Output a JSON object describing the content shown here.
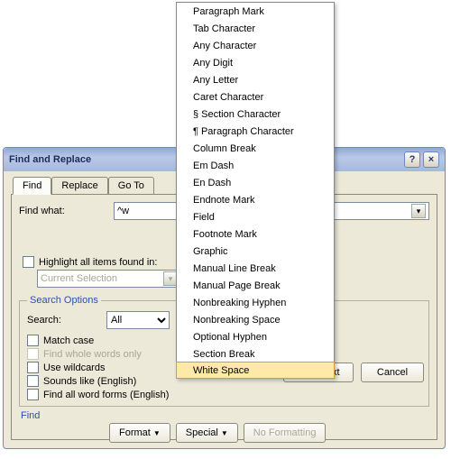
{
  "dialog": {
    "title": "Find and Replace"
  },
  "tabs": {
    "find": "Find",
    "replace": "Replace",
    "goto": "Go To"
  },
  "findwhat": {
    "label": "Find what:",
    "value": "^w"
  },
  "highlight": {
    "label": "Highlight all items found in:",
    "selection": "Current Selection"
  },
  "buttons": {
    "findnext": "Find Next",
    "cancel": "Cancel",
    "format": "Format",
    "special": "Special",
    "noformatting": "No Formatting"
  },
  "searchoptions": {
    "legend": "Search Options",
    "search_label": "Search:",
    "search_value": "All",
    "matchcase": "Match case",
    "wholewords": "Find whole words only",
    "wildcards": "Use wildcards",
    "soundslike": "Sounds like (English)",
    "wordforms": "Find all word forms (English)"
  },
  "findsection": "Find",
  "menu": {
    "items": [
      "Paragraph Mark",
      "Tab Character",
      "Any Character",
      "Any Digit",
      "Any Letter",
      "Caret Character",
      "§ Section Character",
      "¶ Paragraph Character",
      "Column Break",
      "Em Dash",
      "En Dash",
      "Endnote Mark",
      "Field",
      "Footnote Mark",
      "Graphic",
      "Manual Line Break",
      "Manual Page Break",
      "Nonbreaking Hyphen",
      "Nonbreaking Space",
      "Optional Hyphen",
      "Section Break",
      "White Space"
    ],
    "highlighted_index": 21
  }
}
